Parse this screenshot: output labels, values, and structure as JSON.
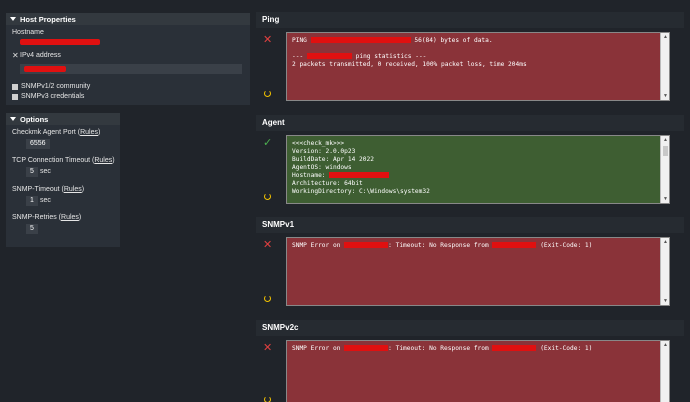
{
  "host_properties": {
    "title": "Host Properties",
    "hostname_label": "Hostname",
    "ipv4_label": "IPv4 address",
    "snmp_v12_label": "SNMPv1/2 community",
    "snmp_v3_label": "SNMPv3 credentials"
  },
  "options": {
    "title": "Options",
    "agent_port": {
      "label": "Checkmk Agent Port",
      "rules": "Rules",
      "value": "6556"
    },
    "tcp_timeout": {
      "label": "TCP Connection Timeout",
      "rules": "Rules",
      "value": "5",
      "unit": "sec"
    },
    "snmp_timeout": {
      "label": "SNMP-Timeout",
      "rules": "Rules",
      "value": "1",
      "unit": "sec"
    },
    "snmp_retries": {
      "label": "SNMP-Retries",
      "rules": "Rules",
      "value": "5"
    }
  },
  "ping": {
    "title": "Ping",
    "line1_prefix": "PING ",
    "line1_suffix": " 56(84) bytes of data.",
    "line3_prefix": "--- ",
    "line3_suffix": " ping statistics ---",
    "line4": "2 packets transmitted, 0 received, 100% packet loss, time 204ms"
  },
  "agent": {
    "title": "Agent",
    "lines": [
      "<<<check_mk>>>",
      "Version: 2.0.0p23",
      "BuildDate: Apr 14 2022",
      "AgentOS: windows",
      "Hostname: ",
      "Architecture: 64bit",
      "WorkingDirectory: C:\\Windows\\system32"
    ]
  },
  "snmpv1": {
    "title": "SNMPv1",
    "p1": "SNMP Error on ",
    "p2": ": Timeout: No Response from ",
    "p3": " (Exit-Code: 1)"
  },
  "snmpv2c": {
    "title": "SNMPv2c",
    "p1": "SNMP Error on ",
    "p2": ": Timeout: No Response from ",
    "p3": " (Exit-Code: 1)"
  }
}
